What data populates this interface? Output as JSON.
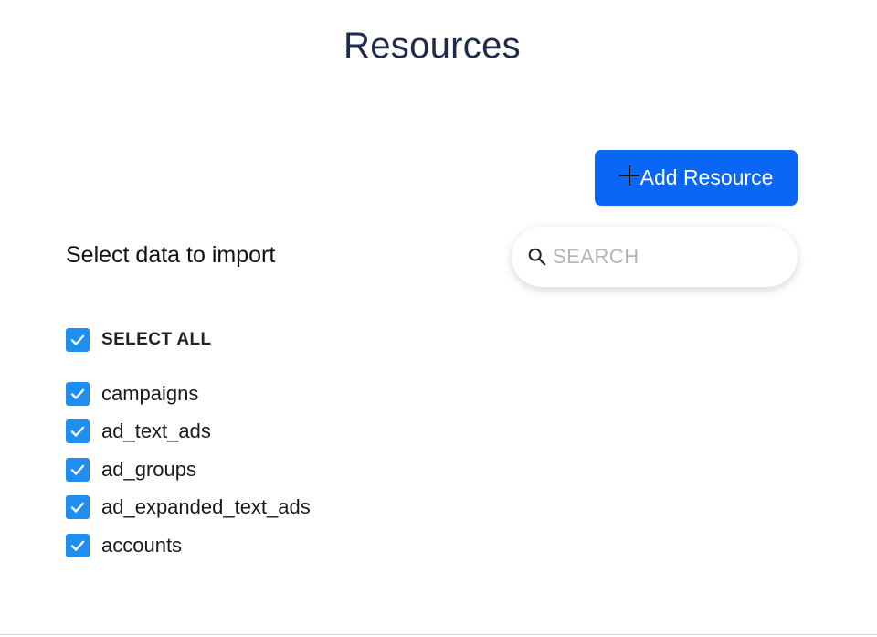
{
  "page": {
    "title": "Resources"
  },
  "toolbar": {
    "add_resource_label": "Add Resource",
    "add_icon": "plus-icon",
    "accent_color": "#0a66f5"
  },
  "section": {
    "heading": "Select data to import"
  },
  "search": {
    "value": "",
    "placeholder": "SEARCH",
    "icon": "search-icon"
  },
  "select_all": {
    "label": "SELECT ALL",
    "checked": true
  },
  "resources": [
    {
      "label": "campaigns",
      "checked": true
    },
    {
      "label": "ad_text_ads",
      "checked": true
    },
    {
      "label": "ad_groups",
      "checked": true
    },
    {
      "label": "ad_expanded_text_ads",
      "checked": true
    },
    {
      "label": "accounts",
      "checked": true
    }
  ],
  "colors": {
    "checkbox": "#1f8ef1",
    "title": "#1f2a4e"
  }
}
